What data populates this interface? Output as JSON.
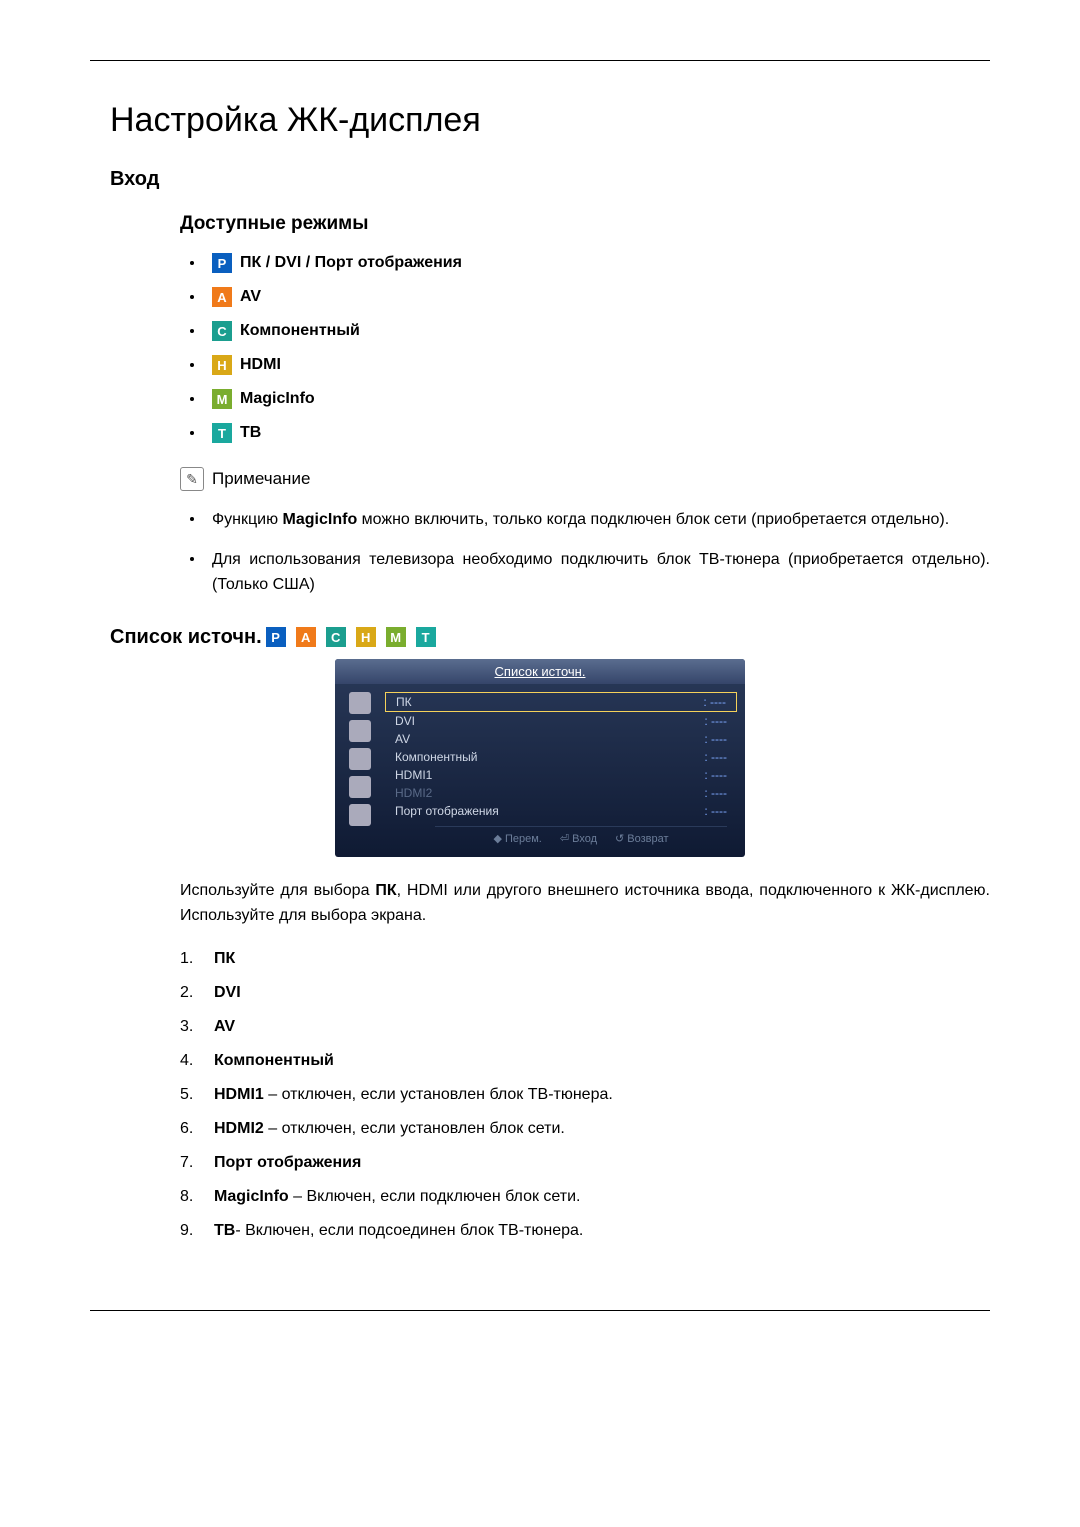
{
  "title": "Настройка ЖК-дисплея",
  "section": "Вход",
  "subsection": "Доступные режимы",
  "modes": {
    "p_letter": "P",
    "p_text": "ПК / DVI / Порт отображения",
    "a_letter": "A",
    "a_text": "AV",
    "c_letter": "C",
    "c_text": "Компонентный",
    "h_letter": "H",
    "h_text": "HDMI",
    "m_letter": "M",
    "m_text": "MagicInfo",
    "t_letter": "T",
    "t_text": "ТВ"
  },
  "note_label": "Примечание",
  "notes": {
    "n1_a": "Функцию ",
    "n1_b": "MagicInfo",
    "n1_c": " можно включить, только когда подключен блок сети (приобретается отдельно).",
    "n2": "Для использования телевизора необходимо подключить блок ТВ-тюнера (приобретается отдельно).(Только США)"
  },
  "source_label": "Список источн.",
  "badges": {
    "p": "P",
    "a": "A",
    "c": "C",
    "h": "H",
    "m": "M",
    "t": "T"
  },
  "osd": {
    "title": "Список источн.",
    "items": {
      "r1": {
        "label": "ПК",
        "val": ": ----"
      },
      "r2": {
        "label": "DVI",
        "val": ": ----"
      },
      "r3": {
        "label": "AV",
        "val": ": ----"
      },
      "r4": {
        "label": "Компонентный",
        "val": ": ----"
      },
      "r5": {
        "label": "HDMI1",
        "val": ": ----"
      },
      "r6": {
        "label": "HDMI2",
        "val": ": ----"
      },
      "r7": {
        "label": "Порт отображения",
        "val": ": ----"
      }
    },
    "footer": {
      "move": "◆ Перем.",
      "enter": "⏎ Вход",
      "return": "↺ Возврат"
    }
  },
  "desc_a": "Используйте для выбора ",
  "desc_b": "ПК",
  "desc_c": ", HDMI или другого внешнего источника ввода, подключенного к ЖК-дисплею. Используйте для выбора экрана.",
  "numbered": {
    "n1_num": "1.",
    "n1": "ПК",
    "n2_num": "2.",
    "n2": "DVI",
    "n3_num": "3.",
    "n3": "AV",
    "n4_num": "4.",
    "n4": "Компонентный",
    "n5_num": "5.",
    "n5_b": "HDMI1",
    "n5_t": " – отключен, если установлен блок ТВ-тюнера.",
    "n6_num": "6.",
    "n6_b": "HDMI2",
    "n6_t": " – отключен, если установлен блок сети.",
    "n7_num": "7.",
    "n7": "Порт отображения",
    "n8_num": "8.",
    "n8_b": "MagicInfo",
    "n8_t": " – Включен, если подключен блок сети.",
    "n9_num": "9.",
    "n9_b": "ТВ",
    "n9_t": "- Включен, если подсоединен блок ТВ-тюнера."
  }
}
